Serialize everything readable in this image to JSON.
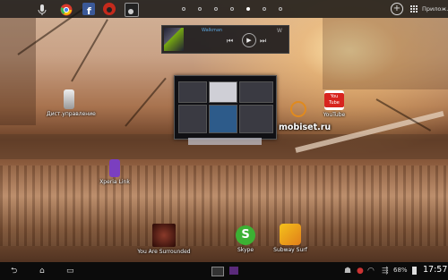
{
  "statusbar": {
    "pinned_apps": [
      {
        "icon": "microphone-icon"
      },
      {
        "icon": "chrome-icon"
      },
      {
        "icon": "facebook-icon"
      },
      {
        "icon": "app-icon"
      },
      {
        "icon": "camera-icon"
      }
    ],
    "page_indicator": {
      "count": 7,
      "active_index": 4
    },
    "add_icon": "plus-icon",
    "apps_label": "Прилож."
  },
  "music_widget": {
    "track_title": "Walkman",
    "controls": [
      "prev",
      "play",
      "next"
    ]
  },
  "shortcuts": {
    "remote": {
      "label": "Дист.управление"
    },
    "youtube": {
      "label": "YouTube",
      "icon_text": "You Tube"
    },
    "xperia": {
      "label": "Xperia Link"
    },
    "you_are_surrounded": {
      "label": "You Are Surrounded"
    },
    "skype": {
      "label": "Skype"
    },
    "subway": {
      "label": "Subway Surf"
    }
  },
  "watermark": "mobiset.ru",
  "navbar": {
    "battery": "68%",
    "clock": "17:57"
  },
  "colors": {
    "statusbar_bg": "#0f0f0f",
    "youtube_red": "#d8241e",
    "skype_green": "#3cb133",
    "xperia_purple": "#7b3fbf"
  }
}
